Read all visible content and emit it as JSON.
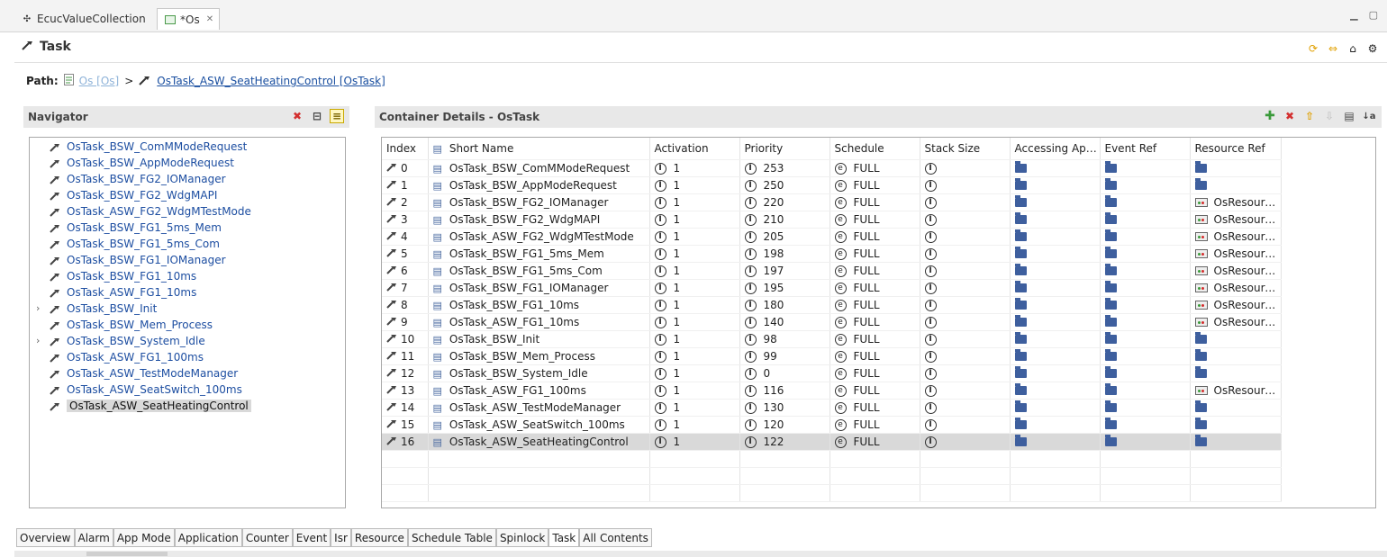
{
  "tabs": [
    {
      "label": "EcucValueCollection",
      "icon": "cross-icon",
      "active": false
    },
    {
      "label": "*Os",
      "icon": "editor-icon",
      "active": true
    }
  ],
  "header": {
    "title": "Task"
  },
  "path": {
    "label": "Path:",
    "parent": "Os [Os]",
    "separator": ">",
    "current": "OsTask_ASW_SeatHeatingControl [OsTask]"
  },
  "navigator": {
    "title": "Navigator",
    "items": [
      {
        "label": "OsTask_BSW_ComMModeRequest",
        "expandable": false
      },
      {
        "label": "OsTask_BSW_AppModeRequest",
        "expandable": false
      },
      {
        "label": "OsTask_BSW_FG2_IOManager",
        "expandable": false
      },
      {
        "label": "OsTask_BSW_FG2_WdgMAPI",
        "expandable": false
      },
      {
        "label": "OsTask_ASW_FG2_WdgMTestMode",
        "expandable": false
      },
      {
        "label": "OsTask_BSW_FG1_5ms_Mem",
        "expandable": false
      },
      {
        "label": "OsTask_BSW_FG1_5ms_Com",
        "expandable": false
      },
      {
        "label": "OsTask_BSW_FG1_IOManager",
        "expandable": false
      },
      {
        "label": "OsTask_BSW_FG1_10ms",
        "expandable": false
      },
      {
        "label": "OsTask_ASW_FG1_10ms",
        "expandable": false
      },
      {
        "label": "OsTask_BSW_Init",
        "expandable": true
      },
      {
        "label": "OsTask_BSW_Mem_Process",
        "expandable": false
      },
      {
        "label": "OsTask_BSW_System_Idle",
        "expandable": true
      },
      {
        "label": "OsTask_ASW_FG1_100ms",
        "expandable": false
      },
      {
        "label": "OsTask_ASW_TestModeManager",
        "expandable": false
      },
      {
        "label": "OsTask_ASW_SeatSwitch_100ms",
        "expandable": false
      },
      {
        "label": "OsTask_ASW_SeatHeatingControl",
        "expandable": false,
        "selected": true
      }
    ]
  },
  "details": {
    "title": "Container Details - OsTask",
    "columns": [
      "Index",
      "Short Name",
      "Activation",
      "Priority",
      "Schedule",
      "Stack Size",
      "Accessing App...",
      "Event Ref",
      "Resource Ref"
    ],
    "rows": [
      {
        "index": "0",
        "name": "OsTask_BSW_ComMModeRequest",
        "activation": "1",
        "priority": "253",
        "schedule": "FULL",
        "resource": ""
      },
      {
        "index": "1",
        "name": "OsTask_BSW_AppModeRequest",
        "activation": "1",
        "priority": "250",
        "schedule": "FULL",
        "resource": ""
      },
      {
        "index": "2",
        "name": "OsTask_BSW_FG2_IOManager",
        "activation": "1",
        "priority": "220",
        "schedule": "FULL",
        "resource": "OsResourc..."
      },
      {
        "index": "3",
        "name": "OsTask_BSW_FG2_WdgMAPI",
        "activation": "1",
        "priority": "210",
        "schedule": "FULL",
        "resource": "OsResourc..."
      },
      {
        "index": "4",
        "name": "OsTask_ASW_FG2_WdgMTestMode",
        "activation": "1",
        "priority": "205",
        "schedule": "FULL",
        "resource": "OsResourc..."
      },
      {
        "index": "5",
        "name": "OsTask_BSW_FG1_5ms_Mem",
        "activation": "1",
        "priority": "198",
        "schedule": "FULL",
        "resource": "OsResourc..."
      },
      {
        "index": "6",
        "name": "OsTask_BSW_FG1_5ms_Com",
        "activation": "1",
        "priority": "197",
        "schedule": "FULL",
        "resource": "OsResourc..."
      },
      {
        "index": "7",
        "name": "OsTask_BSW_FG1_IOManager",
        "activation": "1",
        "priority": "195",
        "schedule": "FULL",
        "resource": "OsResourc..."
      },
      {
        "index": "8",
        "name": "OsTask_BSW_FG1_10ms",
        "activation": "1",
        "priority": "180",
        "schedule": "FULL",
        "resource": "OsResourc..."
      },
      {
        "index": "9",
        "name": "OsTask_ASW_FG1_10ms",
        "activation": "1",
        "priority": "140",
        "schedule": "FULL",
        "resource": "OsResourc..."
      },
      {
        "index": "10",
        "name": "OsTask_BSW_Init",
        "activation": "1",
        "priority": "98",
        "schedule": "FULL",
        "resource": ""
      },
      {
        "index": "11",
        "name": "OsTask_BSW_Mem_Process",
        "activation": "1",
        "priority": "99",
        "schedule": "FULL",
        "resource": ""
      },
      {
        "index": "12",
        "name": "OsTask_BSW_System_Idle",
        "activation": "1",
        "priority": "0",
        "schedule": "FULL",
        "resource": ""
      },
      {
        "index": "13",
        "name": "OsTask_ASW_FG1_100ms",
        "activation": "1",
        "priority": "116",
        "schedule": "FULL",
        "resource": "OsResourc..."
      },
      {
        "index": "14",
        "name": "OsTask_ASW_TestModeManager",
        "activation": "1",
        "priority": "130",
        "schedule": "FULL",
        "resource": ""
      },
      {
        "index": "15",
        "name": "OsTask_ASW_SeatSwitch_100ms",
        "activation": "1",
        "priority": "120",
        "schedule": "FULL",
        "resource": ""
      },
      {
        "index": "16",
        "name": "OsTask_ASW_SeatHeatingControl",
        "activation": "1",
        "priority": "122",
        "schedule": "FULL",
        "resource": "",
        "selected": true
      }
    ]
  },
  "bottom_tabs": [
    "Overview",
    "Alarm",
    "App Mode",
    "Application",
    "Counter",
    "Event",
    "Isr",
    "Resource",
    "Schedule Table",
    "Spinlock",
    "Task",
    "All Contents"
  ],
  "active_bottom_tab": "Task",
  "colors": {
    "link": "#1d4ea1",
    "link_muted": "#8fb3d9",
    "panel_header": "#e8e8e8",
    "selected_row": "#d9d9d9",
    "folder": "#3e5f9e",
    "delete": "#d32f2f",
    "add": "#3a9a3a",
    "arrow": "#e0a000"
  }
}
